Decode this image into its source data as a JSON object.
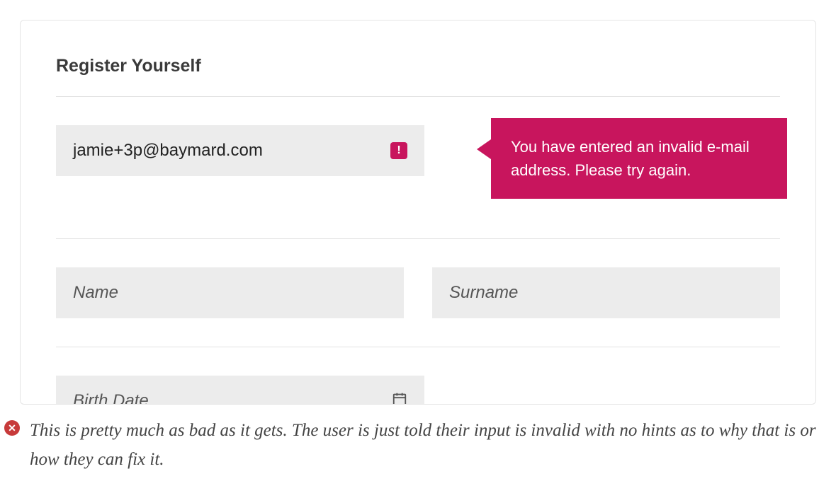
{
  "form": {
    "title": "Register Yourself",
    "email": {
      "value": "jamie+3p@baymard.com",
      "error_badge": "!",
      "error_message": "You have entered an invalid e-mail address. Please try again."
    },
    "name": {
      "placeholder": "Name"
    },
    "surname": {
      "placeholder": "Surname"
    },
    "birth": {
      "placeholder": "Birth Date"
    }
  },
  "caption": {
    "icon": "✕",
    "text": "This is pretty much as bad as it gets. The user is just told their input is invalid with no hints as to why that is or how they can fix it."
  }
}
